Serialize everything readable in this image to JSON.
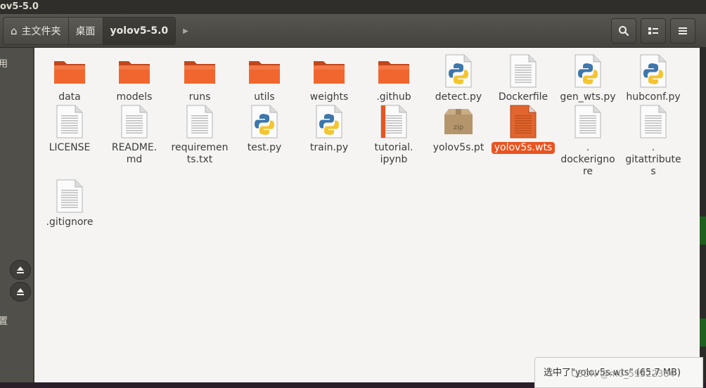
{
  "window": {
    "title": "ov5-5.0"
  },
  "pathbar": {
    "crumbs": [
      "主文件夹",
      "桌面",
      "yolov5-5.0"
    ]
  },
  "sidebar": {
    "label_top": "用",
    "label_bottom": "置"
  },
  "files": [
    {
      "name": "data",
      "type": "folder"
    },
    {
      "name": "models",
      "type": "folder"
    },
    {
      "name": "runs",
      "type": "folder"
    },
    {
      "name": "utils",
      "type": "folder"
    },
    {
      "name": "weights",
      "type": "folder"
    },
    {
      "name": ".github",
      "type": "folder"
    },
    {
      "name": "detect.py",
      "type": "python"
    },
    {
      "name": "Dockerfile",
      "type": "text"
    },
    {
      "name": "gen_wts.py",
      "type": "python"
    },
    {
      "name": "hubconf.py",
      "type": "python"
    },
    {
      "name": "LICENSE",
      "type": "text"
    },
    {
      "name": "README.\nmd",
      "type": "text"
    },
    {
      "name": "requiremen\nts.txt",
      "type": "text"
    },
    {
      "name": "test.py",
      "type": "python"
    },
    {
      "name": "train.py",
      "type": "python"
    },
    {
      "name": "tutorial.\nipynb",
      "type": "notebook"
    },
    {
      "name": "yolov5s.pt",
      "type": "zip"
    },
    {
      "name": "yolov5s.wts",
      "type": "wts",
      "selected": true
    },
    {
      "name": ".\ndockerigno\nre",
      "type": "text"
    },
    {
      "name": ".\ngitattribute\ns",
      "type": "text"
    },
    {
      "name": ".gitignore",
      "type": "text"
    }
  ],
  "status": {
    "text": "选中了\"yolov5s.wts\" (65.7 MB)"
  },
  "watermark": {
    "text": "CSDN @m0_59322384"
  },
  "colors": {
    "accent": "#e95420",
    "folder": "#f0662e"
  }
}
